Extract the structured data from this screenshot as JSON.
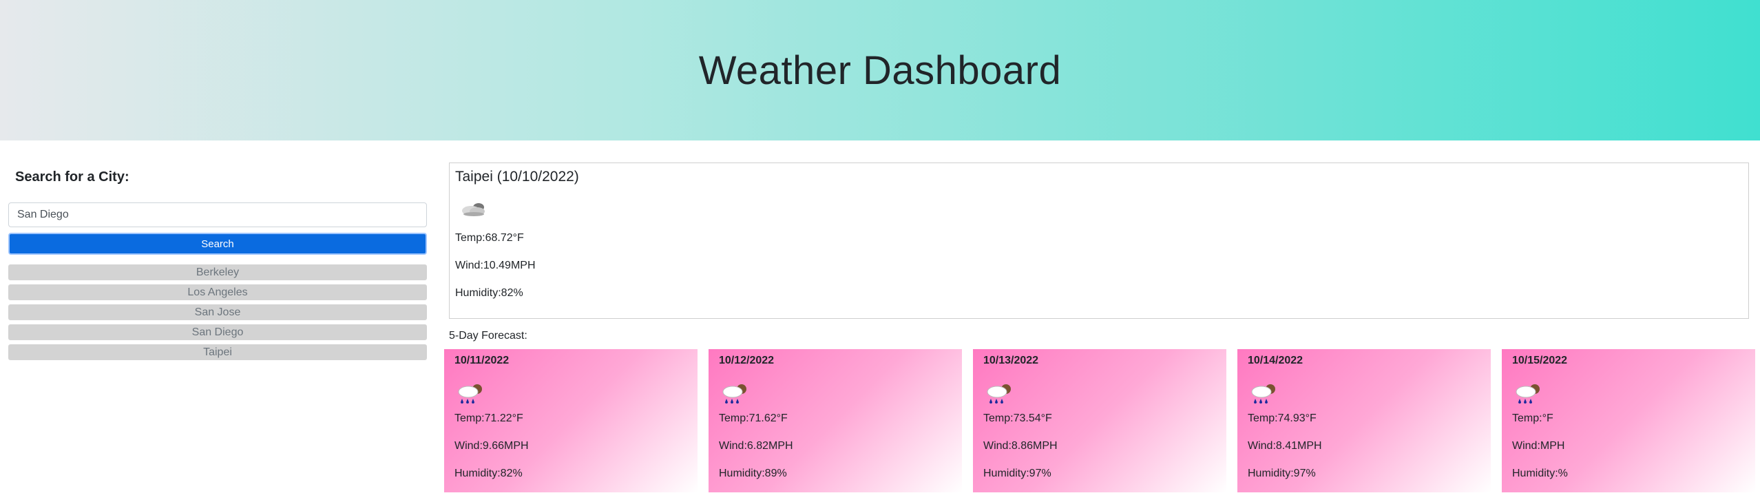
{
  "header": {
    "title": "Weather Dashboard"
  },
  "sidebar": {
    "heading": "Search for a City:",
    "search": {
      "value": "San Diego",
      "placeholder": ""
    },
    "search_button_label": "Search",
    "history": [
      {
        "label": "Berkeley"
      },
      {
        "label": "Los Angeles"
      },
      {
        "label": "San Jose"
      },
      {
        "label": "San Diego"
      },
      {
        "label": "Taipei"
      }
    ]
  },
  "current": {
    "title": "Taipei (10/10/2022)",
    "icon": "cloudy-night-icon",
    "temp": "Temp:68.72°F",
    "wind": "Wind:10.49MPH",
    "humidity": "Humidity:82%"
  },
  "forecast": {
    "label": "5-Day Forecast:",
    "days": [
      {
        "date": "10/11/2022",
        "icon": "rain-cloud-icon",
        "temp": "Temp:71.22°F",
        "wind": "Wind:9.66MPH",
        "humidity": "Humidity:82%"
      },
      {
        "date": "10/12/2022",
        "icon": "rain-cloud-icon",
        "temp": "Temp:71.62°F",
        "wind": "Wind:6.82MPH",
        "humidity": "Humidity:89%"
      },
      {
        "date": "10/13/2022",
        "icon": "rain-cloud-icon",
        "temp": "Temp:73.54°F",
        "wind": "Wind:8.86MPH",
        "humidity": "Humidity:97%"
      },
      {
        "date": "10/14/2022",
        "icon": "rain-cloud-icon",
        "temp": "Temp:74.93°F",
        "wind": "Wind:8.41MPH",
        "humidity": "Humidity:97%"
      },
      {
        "date": "10/15/2022",
        "icon": "rain-cloud-icon",
        "temp": "Temp:°F",
        "wind": "Wind:MPH",
        "humidity": "Humidity:%"
      }
    ]
  },
  "colors": {
    "header_gradient_start": "#e6e9ec",
    "header_gradient_end": "#40e0d0",
    "search_button": "#0a6be0",
    "history_button": "#d3d3d3",
    "card_gradient_start": "#ff79c1",
    "card_gradient_end": "#ffffff"
  }
}
